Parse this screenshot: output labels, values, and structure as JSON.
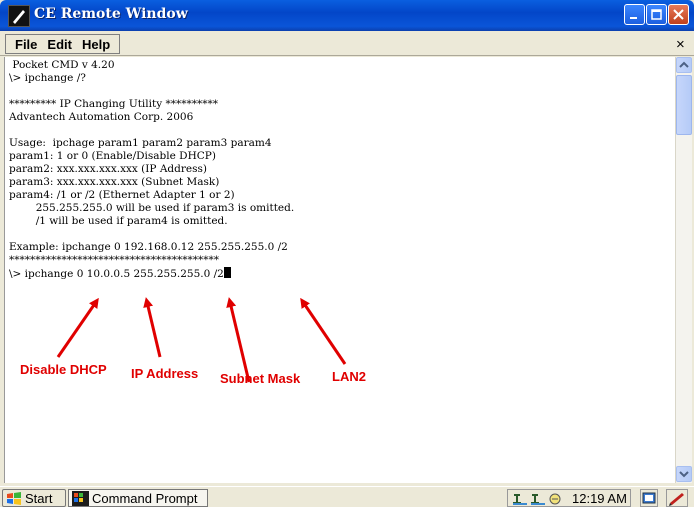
{
  "window": {
    "title": "CE Remote Window"
  },
  "menu": {
    "file": "File",
    "edit": "Edit",
    "help": "Help",
    "close_glyph": "×"
  },
  "terminal": {
    "lines": [
      " Pocket CMD v 4.20",
      "\\> ipchange /?",
      "",
      "********* IP Changing Utility **********",
      "Advantech Automation Corp. 2006",
      "",
      "Usage:  ipchage param1 param2 param3 param4",
      "param1: 1 or 0 (Enable/Disable DHCP)",
      "param2: xxx.xxx.xxx.xxx (IP Address)",
      "param3: xxx.xxx.xxx.xxx (Subnet Mask)",
      "param4: /1 or /2 (Ethernet Adapter 1 or 2)",
      "        255.255.255.0 will be used if param3 is omitted.",
      "        /1 will be used if param4 is omitted.",
      "",
      "Example: ipchange 0 192.168.0.12 255.255.255.0 /2",
      "****************************************"
    ],
    "prompt_line": "\\> ipchange 0 10.0.0.5 255.255.255.0 /2"
  },
  "annotations": {
    "disable_dhcp": "Disable DHCP",
    "ip_address": "IP Address",
    "subnet_mask": "Subnet Mask",
    "lan2": "LAN2",
    "color": "#e00000"
  },
  "taskbar": {
    "start": "Start",
    "task": "Command Prompt",
    "clock": "12:19 AM"
  },
  "colors": {
    "titlebar": "#0a55d8",
    "annotation": "#e00000"
  }
}
